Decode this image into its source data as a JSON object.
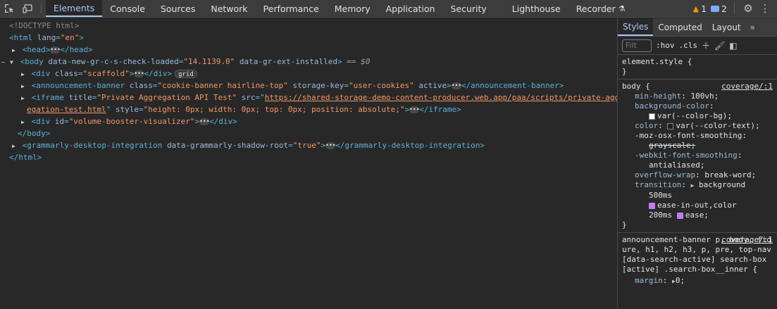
{
  "toolbar": {
    "tabs": [
      "Elements",
      "Console",
      "Sources",
      "Network",
      "Performance",
      "Memory",
      "Application",
      "Security",
      "Lighthouse",
      "Recorder"
    ],
    "warnings": "1",
    "messages": "2"
  },
  "tree": {
    "doctype": "<!DOCTYPE html>",
    "html_open": "<html",
    "html_lang_attr": "lang",
    "html_lang_val": "\"en\"",
    "head_open": "<head>",
    "head_close": "</head>",
    "body_open": "<body",
    "body_attr1": "data-new-gr-c-s-check-loaded",
    "body_val1": "\"14.1139.0\"",
    "body_attr2": "data-gr-ext-installed",
    "body_selected": "== $0",
    "div_open": "<div",
    "class_attr": "class",
    "scaffold_val": "\"scaffold\"",
    "div_close": "</div>",
    "grid_badge": "grid",
    "ann_open": "<announcement-banner",
    "ann_class_val": "\"cookie-banner hairline-top\"",
    "ann_key_attr": "storage-key",
    "ann_key_val": "\"user-cookies\"",
    "ann_active_attr": "active",
    "ann_close": "</announcement-banner>",
    "iframe_open": "<iframe",
    "iframe_title_attr": "title",
    "iframe_title_val": "\"Private Aggregation API Test\"",
    "iframe_src_attr": "src",
    "iframe_src_val_1": "https://shared-storage-demo-content-producer.web.app/paa/scripts/private-aggr",
    "iframe_src_val_2": "egation-test.html",
    "iframe_style_attr": "style",
    "iframe_style_val": "\"height: 0px; width: 0px; top: 0px; position: absolute;\"",
    "iframe_close": "</iframe>",
    "vb_id_attr": "id",
    "vb_id_val": "\"volume-booster-visualizer\"",
    "body_close": "</body>",
    "gram_open": "<grammarly-desktop-integration",
    "gram_attr": "data-grammarly-shadow-root",
    "gram_val": "\"true\"",
    "gram_close": "</grammarly-desktop-integration>",
    "html_close": "</html>"
  },
  "styles": {
    "tabs": [
      "Styles",
      "Computed",
      "Layout"
    ],
    "filter_placeholder": "Filt",
    "hov": ":hov",
    "cls": ".cls",
    "element_style": "element.style {",
    "close_brace": "}",
    "body_selector": "body {",
    "coverage": "coverage/:1",
    "p1_name": "min-height",
    "p1_val": "100vh;",
    "p2_name": "background-color",
    "p2_val": "var(--color-bg);",
    "p3_name": "color",
    "p3_val": "var(--color-text);",
    "p4_name": "-moz-osx-font-smoothing",
    "p4_val": "grayscale;",
    "p5_name": "-webkit-font-smoothing",
    "p5_val": "antialiased;",
    "p6_name": "overflow-wrap",
    "p6_val": "break-word;",
    "p7_name": "transition",
    "p7_val_1": "background",
    "p7_val_2": "500ms",
    "p7_val_3": "ease-in-out,color",
    "p7_val_4": "200ms",
    "p7_val_5": "ease;",
    "rule3_selector": "announcement-banner p, body, figure, h1, h2, h3, p, pre, top-nav[data-search-active] search-box[active] .search-box__inner {",
    "margin_name": "margin",
    "margin_val": "0;"
  }
}
